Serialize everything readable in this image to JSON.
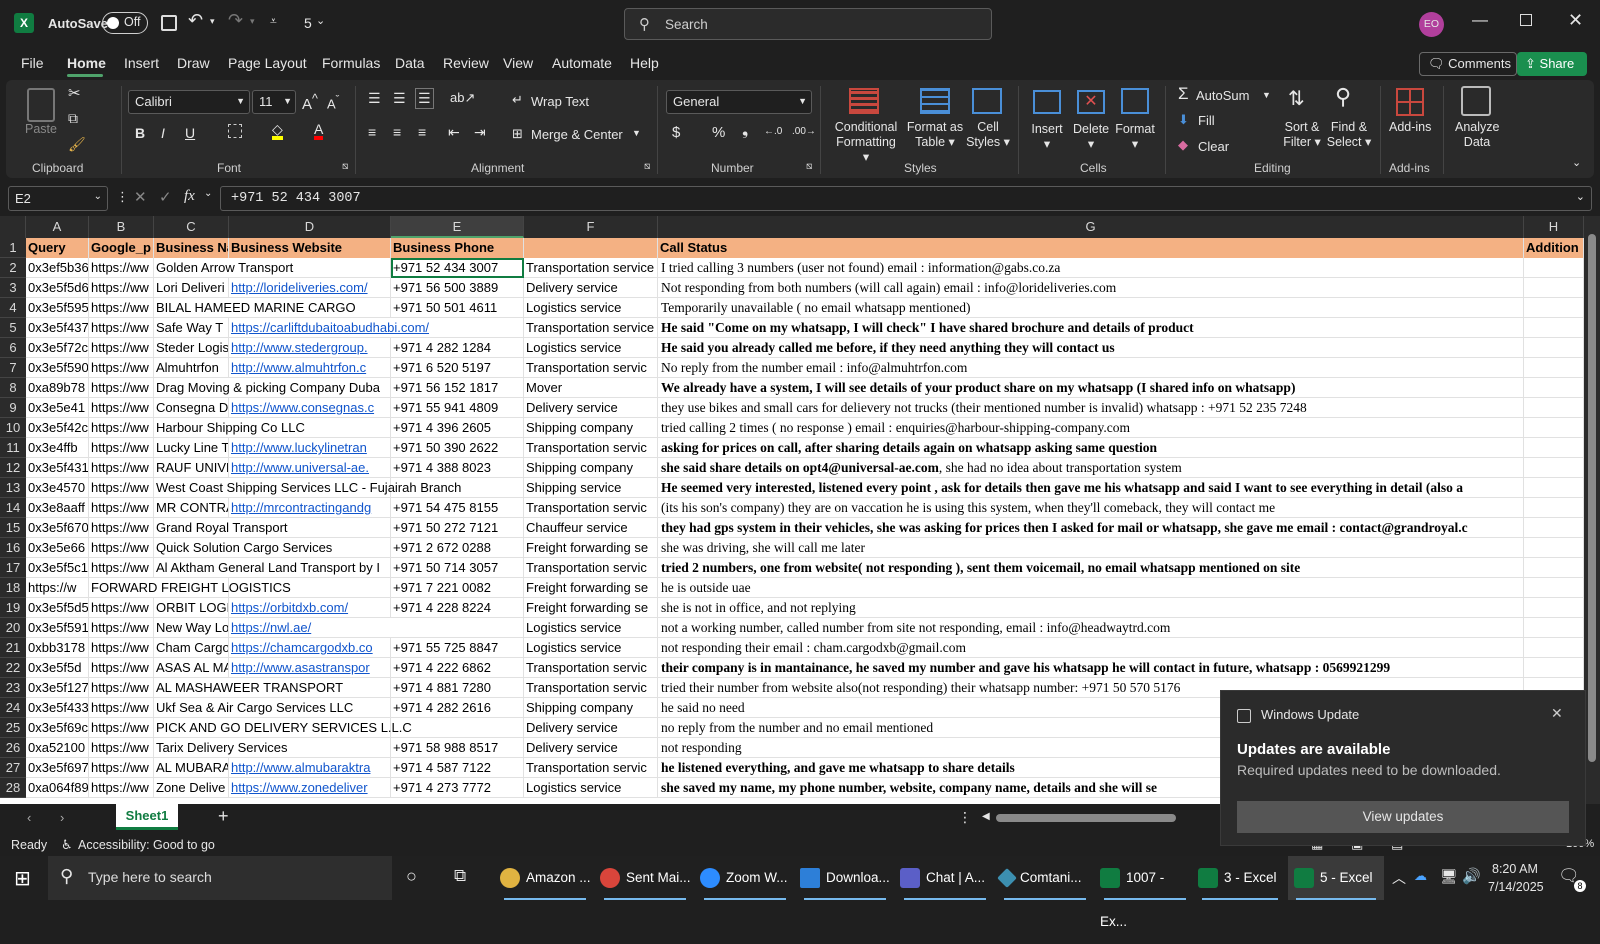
{
  "titlebar": {
    "autosave": "AutoSave",
    "toggle": "Off",
    "quick_number": "5",
    "search_placeholder": "Search",
    "avatar": "EO"
  },
  "menu": [
    "File",
    "Home",
    "Insert",
    "Draw",
    "Page Layout",
    "Formulas",
    "Data",
    "Review",
    "View",
    "Automate",
    "Help"
  ],
  "menu_right": {
    "comments": "Comments",
    "share": "Share"
  },
  "ribbon": {
    "clipboard": {
      "paste": "Paste",
      "label": "Clipboard"
    },
    "font": {
      "name": "Calibri",
      "size": "11",
      "label": "Font"
    },
    "alignment": {
      "wrap": "Wrap Text",
      "merge": "Merge & Center",
      "label": "Alignment"
    },
    "number": {
      "format": "General",
      "label": "Number"
    },
    "styles": {
      "conditional": "Conditional",
      "formatting": "Formatting",
      "format_as": "Format as",
      "table": "Table",
      "cell": "Cell",
      "styles": "Styles",
      "label": "Styles"
    },
    "cells": {
      "insert": "Insert",
      "delete": "Delete",
      "format": "Format",
      "label": "Cells"
    },
    "editing": {
      "autosum": "AutoSum",
      "fill": "Fill",
      "clear": "Clear",
      "sort": "Sort &",
      "filter": "Filter",
      "find": "Find &",
      "select": "Select",
      "label": "Editing"
    },
    "addins": {
      "addins": "Add-ins",
      "label": "Add-ins"
    },
    "analyze": {
      "analyze": "Analyze",
      "data": "Data"
    }
  },
  "formula_bar": {
    "name_box": "E2",
    "fx": "fx",
    "value": "+971 52 434 3007"
  },
  "columns": [
    "A",
    "B",
    "C",
    "D",
    "E",
    "F",
    "G",
    "H"
  ],
  "header_row": {
    "A": "Query",
    "B": "Google_p",
    "C": "Business Na",
    "D": "Business Website",
    "E": "Business Phone",
    "F": "",
    "G": "Call Status",
    "H": "Addition"
  },
  "rows": [
    {
      "n": "2",
      "A": "0x3ef5b36",
      "B": "https://ww",
      "C": "Golden Arrow Transport",
      "D": "",
      "E": "+971 52 434 3007",
      "F": "Transportation service",
      "G": "I tried calling 3 numbers (user not found) email : information@gabs.co.za",
      "gb": false
    },
    {
      "n": "3",
      "A": "0x3e5f5d6",
      "B": "https://ww",
      "C": "Lori Deliveri",
      "D": "http://lorideliveries.com/",
      "E": "+971 56 500 3889",
      "F": "Delivery service",
      "G": "Not responding from both numbers (will call again) email : info@lorideliveries.com",
      "gb": false
    },
    {
      "n": "4",
      "A": "0x3e5f595",
      "B": "https://ww",
      "C": "BILAL HAMEED MARINE CARGO",
      "D": "",
      "E": "+971 50 501 4611",
      "F": "Logistics service",
      "G": "Temporarily unavailable ( no email whatsapp mentioned)",
      "gb": false
    },
    {
      "n": "5",
      "A": "0x3e5f437",
      "B": "https://ww",
      "C": "Safe Way T",
      "D": "https://carliftdubaitoabudhabi.com/",
      "E": "",
      "F": "Transportation service",
      "G": "He said \"Come on my whatsapp, I will check\" I have shared brochure and details of product",
      "gb": true
    },
    {
      "n": "6",
      "A": "0x3e5f72c",
      "B": "https://ww",
      "C": "Steder Logis",
      "D": "http://www.stedergroup.",
      "E": "+971 4 282 1284",
      "F": "Logistics service",
      "G": "He said you already called me before, if they need anything they will contact us",
      "gb": true
    },
    {
      "n": "7",
      "A": "0x3e5f590",
      "B": "https://ww",
      "C": "Almuhtrfon",
      "D": "http://www.almuhtrfon.c",
      "E": "+971 6 520 5197",
      "F": "Transportation servic",
      "G": "No reply from the number  email : info@almuhtrfon.com",
      "gb": false
    },
    {
      "n": "8",
      "A": "0xa89b78",
      "B": "https://ww",
      "C": "Drag Moving & picking Company Duba",
      "D": "",
      "E": "+971 56 152 1817",
      "F": "Mover",
      "G": "We already have a system, I will see details of your product share on my whatsapp (I shared info on whatsapp)",
      "gb": true
    },
    {
      "n": "9",
      "A": "0x3e5e41",
      "B": "https://ww",
      "C": "Consegna D",
      "D": "https://www.consegnas.c",
      "E": "+971 55 941 4809",
      "F": "Delivery service",
      "G": "they use bikes and small cars for delievery not trucks (their mentioned number is invalid) whatsapp : +971 52 235 7248",
      "gb": false
    },
    {
      "n": "10",
      "A": "0x3e5f42c",
      "B": "https://ww",
      "C": "Harbour Shipping Co LLC",
      "D": "",
      "E": "+971 4 396 2605",
      "F": "Shipping company",
      "G": "tried calling 2 times ( no response ) email : enquiries@harbour-shipping-company.com",
      "gb": false
    },
    {
      "n": "11",
      "A": "0x3e4ffb",
      "B": "https://ww",
      "C": "Lucky Line T",
      "D": "http://www.luckylinetran",
      "E": "+971 50 390 2622",
      "F": "Transportation servic",
      "G": "asking for prices on call, after sharing details again on whatsapp asking same question",
      "gb": true
    },
    {
      "n": "12",
      "A": "0x3e5f431",
      "B": "https://ww",
      "C": "RAUF UNIVE",
      "D": "http://www.universal-ae.",
      "E": "+971 4 388 8023",
      "F": "Shipping company",
      "G": "she said share details on opt4@universal-ae.com",
      "G2": ", she had no idea about transportation system",
      "gb": true
    },
    {
      "n": "13",
      "A": "0x3e4570",
      "B": "https://ww",
      "C": "West Coast Shipping Services LLC - Fujairah Branch",
      "D": "",
      "E": "",
      "F": "Shipping service",
      "G": "He seemed very interested, listened every point , ask for details then gave me his whatsapp and said I want to see everything in detail (also a",
      "gb": true
    },
    {
      "n": "14",
      "A": "0x3e8aaff",
      "B": "https://ww",
      "C": "MR CONTRA",
      "D": "http://mrcontractingandg",
      "E": "+971 54 475 8155",
      "F": "Transportation servic",
      "G": "(its his son's company) they are on vaccation he is using this system, when they'll comeback, they will contact me",
      "gb": false
    },
    {
      "n": "15",
      "A": "0x3e5f670",
      "B": "https://ww",
      "C": "Grand Royal Transport",
      "D": "",
      "E": "+971 50 272 7121",
      "F": "Chauffeur service",
      "G": "they had gps system in their vehicles, she was asking for prices then I asked for mail or whatsapp, she gave me email : contact@grandroyal.c",
      "gb": true
    },
    {
      "n": "16",
      "A": "0x3e5e66",
      "B": "https://ww",
      "C": "Quick Solution Cargo Services",
      "D": "",
      "E": "+971 2 672 0288",
      "F": "Freight forwarding se",
      "G": "she was driving, she will call me later",
      "gb": false
    },
    {
      "n": "17",
      "A": "0x3e5f5c1",
      "B": "https://ww",
      "C": "Al Aktham General Land Transport by I",
      "D": "",
      "E": "+971 50 714 3057",
      "F": "Transportation servic",
      "G": "tried 2 numbers, one from website( not responding ), sent them voicemail, no email whatsapp mentioned on site",
      "gb": true
    },
    {
      "n": "18",
      "A": "https://w",
      "B": "FORWARD FREIGHT LOGISTICS",
      "C": "",
      "D": "",
      "E": "+971 7 221 0082",
      "F": "Freight forwarding se",
      "G": "he is outside uae",
      "gb": false,
      "bov": true
    },
    {
      "n": "19",
      "A": "0x3e5f5d5",
      "B": "https://ww",
      "C": "ORBIT LOGIS",
      "D": "https://orbitdxb.com/",
      "E": "+971 4 228 8224",
      "F": "Freight forwarding se",
      "G": "she is not in office, and not replying",
      "gb": false
    },
    {
      "n": "20",
      "A": "0x3e5f591",
      "B": "https://ww",
      "C": "New Way Lo",
      "D": "https://nwl.ae/",
      "E": "",
      "F": "Logistics service",
      "G": "not a working number, called number from site not responding, email : info@headwaytrd.com",
      "gb": false
    },
    {
      "n": "21",
      "A": "0xbb3178",
      "B": "https://ww",
      "C": "Cham Cargo",
      "D": "https://chamcargodxb.co",
      "E": "+971 55 725 8847",
      "F": "Logistics service",
      "G": "not responding their email : cham.cargodxb@gmail.com",
      "gb": false
    },
    {
      "n": "22",
      "A": "0x3e5f5d",
      "B": "https://ww",
      "C": "ASAS AL MA",
      "D": "http://www.asastranspor",
      "E": "+971 4 222 6862",
      "F": "Transportation servic",
      "G": "their company is in mantainance, he saved my number and gave his whatsapp he will contact in future, whatsapp : 0569921299",
      "gb": true
    },
    {
      "n": "23",
      "A": "0x3e5f127",
      "B": "https://ww",
      "C": "AL MASHAWEER TRANSPORT",
      "D": "",
      "E": "+971 4 881 7280",
      "F": "Transportation servic",
      "G": "tried their number from website also(not responding) their whatsapp number: +971 50 570 5176",
      "gb": false
    },
    {
      "n": "24",
      "A": "0x3e5f433",
      "B": "https://ww",
      "C": "Ukf Sea & Air Cargo Services LLC",
      "D": "",
      "E": "+971 4 282 2616",
      "F": "Shipping company",
      "G": "he said no need",
      "gb": false
    },
    {
      "n": "25",
      "A": "0x3e5f69c",
      "B": "https://ww",
      "C": "PICK AND GO DELIVERY SERVICES L.L.C",
      "D": "",
      "E": "",
      "F": "Delivery service",
      "G": "no reply from the number and no email mentioned",
      "gb": false
    },
    {
      "n": "26",
      "A": "0xa52100",
      "B": "https://ww",
      "C": "Tarix Delivery Services",
      "D": "",
      "E": "+971 58 988 8517",
      "F": "Delivery service",
      "G": "not responding",
      "gb": false
    },
    {
      "n": "27",
      "A": "0x3e5f697",
      "B": "https://ww",
      "C": "AL MUBARA",
      "D": "http://www.almubaraktra",
      "E": "+971 4 587 7122",
      "F": "Transportation servic",
      "G": "he listened everything, and gave me whatsapp to share details",
      "gb": true
    },
    {
      "n": "28",
      "A": "0xa064f89",
      "B": "https://ww",
      "C": "Zone Delive",
      "D": "https://www.zonedeliver",
      "E": "+971 4 273 7772",
      "F": "Logistics service",
      "G": "she saved my name, my phone number, website, company name, details and she will se",
      "gb": true
    }
  ],
  "sheet_tab": "Sheet1",
  "status": {
    "ready": "Ready",
    "accessibility": "Accessibility: Good to go",
    "zoom": "100%"
  },
  "toast": {
    "app": "Windows Update",
    "title": "Updates are available",
    "body": "Required updates need to be downloaded.",
    "button": "View updates"
  },
  "taskbar": {
    "search": "Type here to search",
    "apps": [
      "Amazon ...",
      "Sent Mai...",
      "Zoom W...",
      "Downloa...",
      "Chat | A...",
      "Comtani...",
      "1007 - Ex...",
      "3 - Excel",
      "5 - Excel"
    ],
    "time": "8:20 AM",
    "date": "7/14/2025",
    "notif": "8"
  },
  "colors": {
    "accent": "#107c41",
    "header_fill": "#f4b183",
    "link": "#1155cc"
  }
}
